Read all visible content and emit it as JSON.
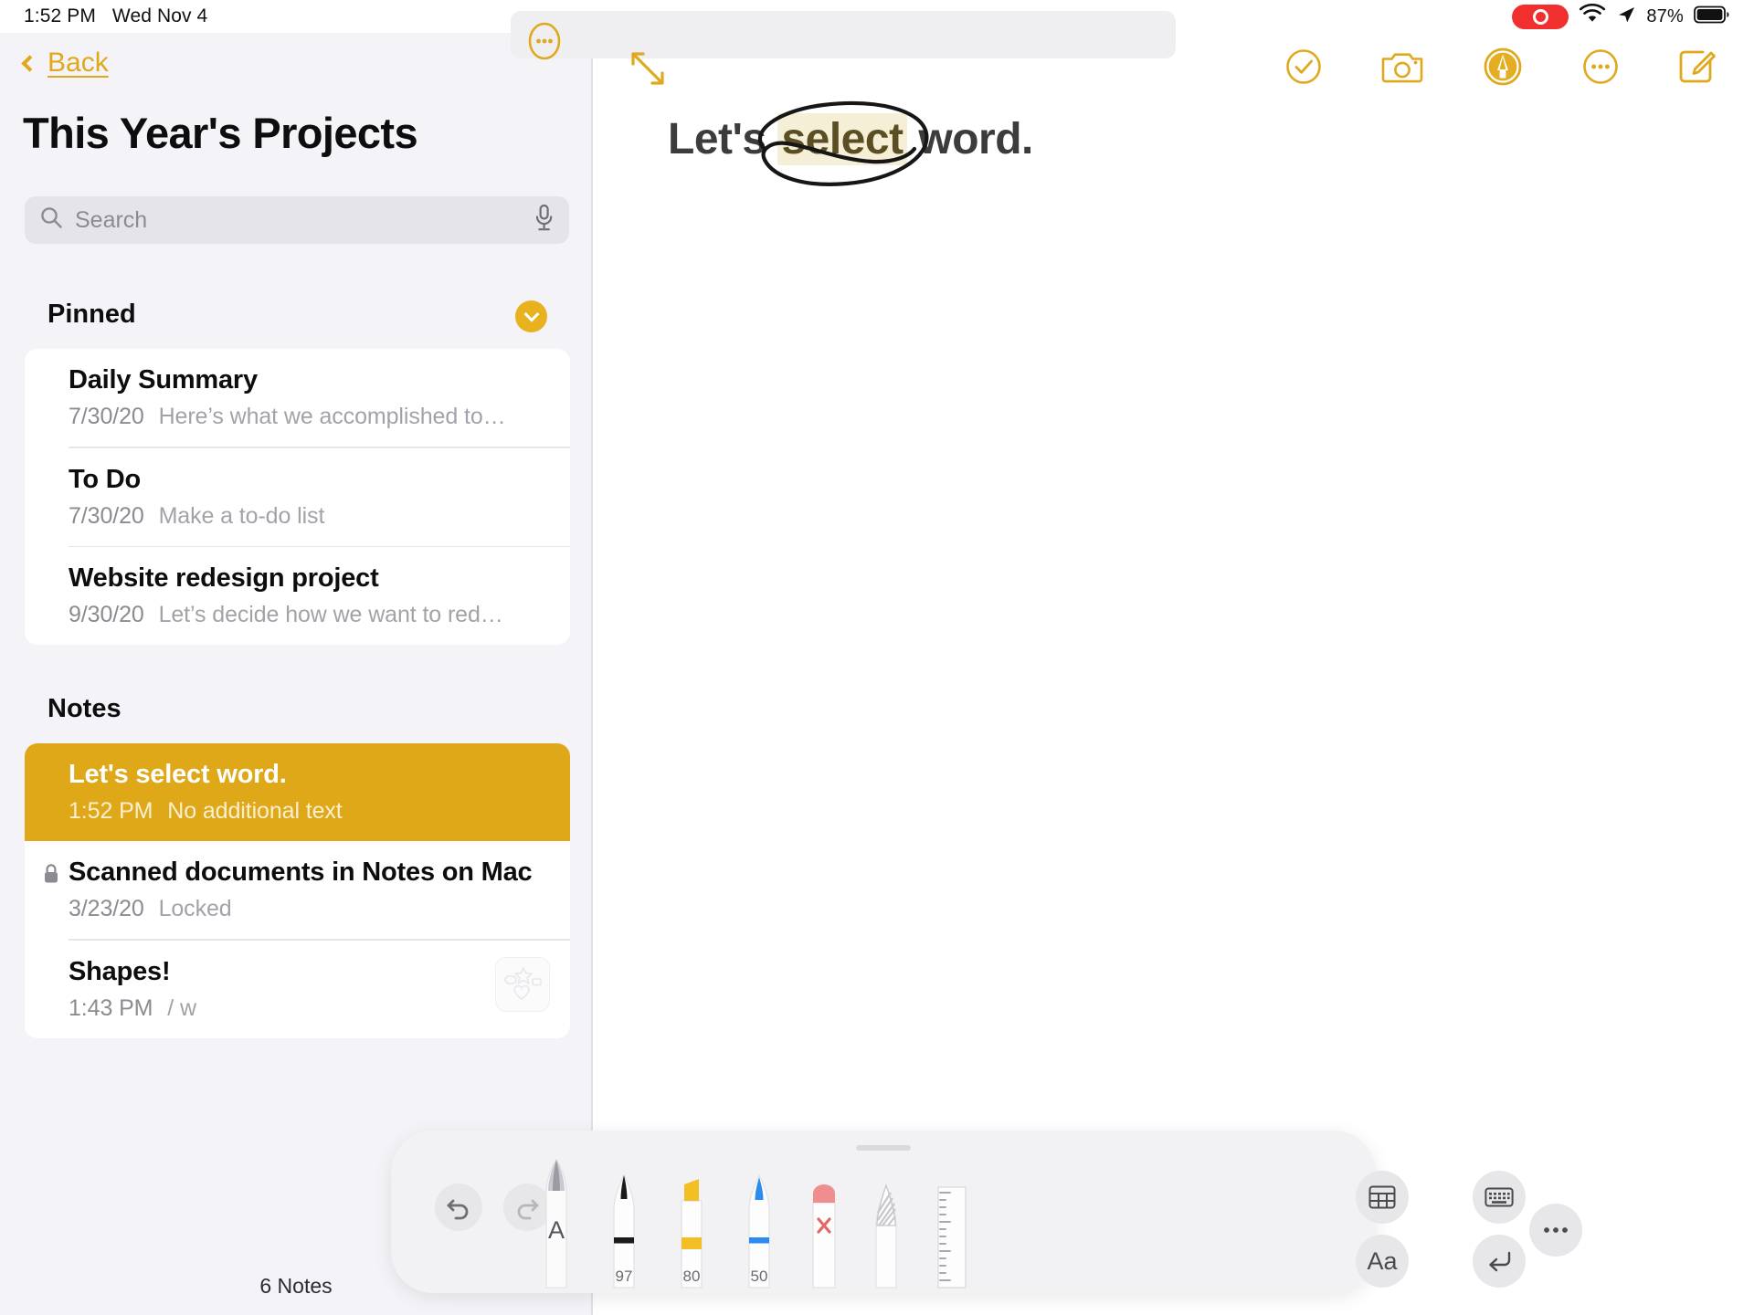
{
  "statusbar": {
    "time": "1:52 PM",
    "date": "Wed Nov 4",
    "recording_icon": "screen-recording-icon",
    "wifi_icon": "wifi-icon",
    "location_icon": "location-arrow-icon",
    "battery_percent": "87%",
    "battery_icon": "battery-icon"
  },
  "sidebar": {
    "back_label": "Back",
    "back_icon": "chevron-left-icon",
    "folder_title": "This Year's Projects",
    "search": {
      "placeholder": "Search",
      "search_icon": "search-icon",
      "mic_icon": "microphone-icon"
    },
    "pinned": {
      "header": "Pinned",
      "toggle_icon": "chevron-down-icon",
      "items": [
        {
          "title": "Daily Summary",
          "date": "7/30/20",
          "snippet": "Here’s what we accomplished to…"
        },
        {
          "title": "To Do",
          "date": "7/30/20",
          "snippet": "Make a to-do list"
        },
        {
          "title": "Website redesign project",
          "date": "9/30/20",
          "snippet": "Let’s decide how we want to red…"
        }
      ]
    },
    "notes": {
      "header": "Notes",
      "items": [
        {
          "title": "Let's select word.",
          "date": "1:52 PM",
          "snippet": "No additional text",
          "selected": true,
          "locked": false,
          "thumb": false
        },
        {
          "title": "Scanned documents in Notes on Mac",
          "date": "3/23/20",
          "snippet": "Locked",
          "selected": false,
          "locked": true,
          "thumb": false
        },
        {
          "title": "Shapes!",
          "date": "1:43 PM",
          "snippet": "/ w",
          "selected": false,
          "locked": false,
          "thumb": true
        }
      ]
    },
    "footer_count": "6 Notes",
    "lock_icon": "lock-icon",
    "thumb_icon": "shapes-thumbnail-icon"
  },
  "editor": {
    "toolbar": {
      "more_icon": "ellipsis-circle-icon",
      "expand_icon": "expand-diagonal-arrows-icon",
      "right_icons": [
        "checklist-circle-icon",
        "camera-icon",
        "markup-pen-icon",
        "more-ellipsis-icon",
        "compose-icon"
      ]
    },
    "note": {
      "text_before": "Let's ",
      "selected_word": "select",
      "text_after": " word.",
      "lasso_annotation": "hand-drawn-lasso-circle"
    }
  },
  "drawbar": {
    "grabber": "drag-handle",
    "undo_icon": "undo-icon",
    "redo_icon": "redo-icon",
    "tools": [
      {
        "name": "apple-pencil-tool",
        "label": "A",
        "size": ""
      },
      {
        "name": "pen-tool",
        "label": "",
        "size": "97",
        "color": "#1B1B1B"
      },
      {
        "name": "highlighter-tool",
        "label": "",
        "size": "80",
        "color": "#F2C024"
      },
      {
        "name": "marker-tool",
        "label": "",
        "size": "50",
        "color": "#2C8BF0"
      },
      {
        "name": "eraser-tool",
        "label": "",
        "size": "",
        "color": "#EE8E8E"
      },
      {
        "name": "lasso-select-tool",
        "label": "",
        "size": "",
        "color": "#BEBEC2"
      },
      {
        "name": "ruler-tool",
        "label": "",
        "size": "",
        "color": "#D6D6DA"
      }
    ],
    "right_buttons": [
      {
        "name": "insert-table-button",
        "icon": "table-icon",
        "label": ""
      },
      {
        "name": "text-style-button",
        "icon": "text-aa-icon",
        "label": "Aa"
      },
      {
        "name": "keyboard-button",
        "icon": "keyboard-icon",
        "label": ""
      },
      {
        "name": "return-button",
        "icon": "return-arrow-icon",
        "label": ""
      },
      {
        "name": "more-options-button",
        "icon": "ellipsis-icon",
        "label": ""
      }
    ]
  },
  "colors": {
    "accent_gold": "#E0A81C",
    "selected_row_gold": "#DFA819",
    "sidebar_bg": "#F4F4F8",
    "highlight_cream": "#F6EFD8",
    "record_red": "#F22F2F"
  }
}
